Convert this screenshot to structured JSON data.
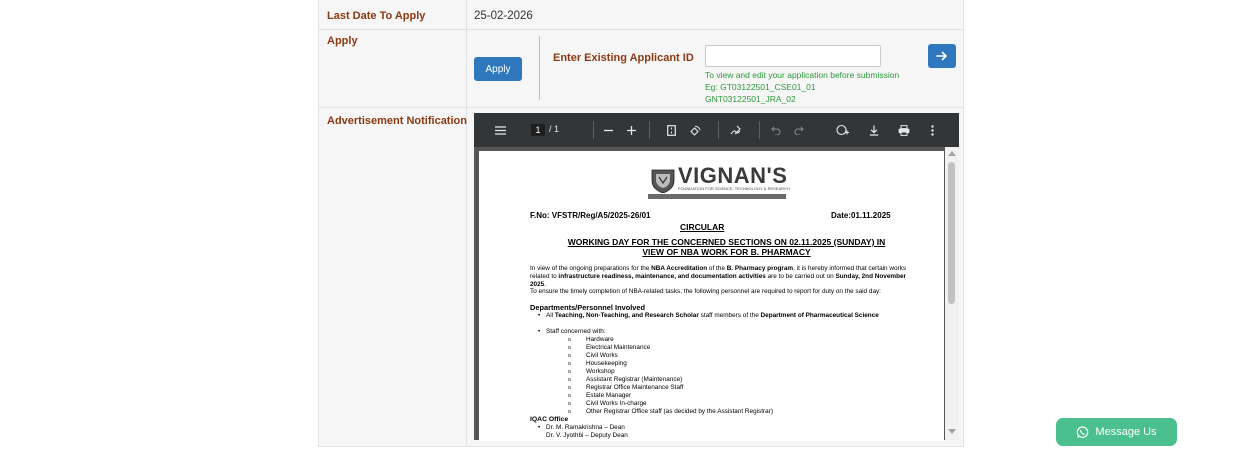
{
  "details": {
    "last_date_label": "Last Date To Apply",
    "last_date_value": "25-02-2026",
    "apply_label": "Apply",
    "apply_button": "Apply",
    "existing_id_label": "Enter Existing Applicant ID",
    "existing_id_value": "",
    "existing_id_placeholder": "",
    "hint_line1": "To view and edit your application before submission",
    "hint_line2": "Eg: GT03122501_CSE01_01",
    "hint_line3": "GNT03122501_JRA_02",
    "advertisement_label": "Advertisement Notification"
  },
  "pdf_viewer": {
    "current_page": "1",
    "total_pages": "/ 1",
    "icons": [
      "menu-icon",
      "zoom-out-icon",
      "zoom-in-icon",
      "fit-page-icon",
      "rotate-icon",
      "draw-icon",
      "undo-icon",
      "redo-icon",
      "add-text-icon",
      "download-icon",
      "print-icon",
      "more-options-icon"
    ]
  },
  "document": {
    "logo_text": "VIGNAN'S",
    "logo_subtitle": "FOUNDATION FOR SCIENCE, TECHNOLOGY & RESEARCH",
    "ref_no": "F.No: VFSTR/Reg/A5/2025-26/01",
    "date": "Date:01.11.2025",
    "circular": "CIRCULAR",
    "heading_line1": "WORKING DAY FOR THE CONCERNED SECTIONS ON 02.11.2025 (SUNDAY) IN",
    "heading_line2": "VIEW OF NBA WORK FOR B. PHARMACY",
    "para1_part1": "In view of the ongoing preparations for the ",
    "para1_bold1": "NBA Accreditation",
    "para1_part2": " of the ",
    "para1_bold2": "B. Pharmacy program",
    "para1_part3": ", it is hereby informed that certain works related to ",
    "para1_bold3": "infrastructure readiness, maintenance, and documentation activities",
    "para1_part4": " are to be carried out on ",
    "para1_bold4": "Sunday, 2nd November 2025",
    "para1_part5": ".",
    "para2": "To ensure the timely completion of NBA-related tasks, the following personnel are required to report for duty on the said day:",
    "departments_heading": "Departments/Personnel Involved",
    "bullet1_part1": "All ",
    "bullet1_bold1": "Teaching, Non-Teaching, and Research Scholar",
    "bullet1_part2": " staff members of the ",
    "bullet1_bold2": "Department of Pharmaceutical Science",
    "bullet2": "Staff concerned with:",
    "staff_items": [
      "Hardware",
      "Electrical Maintenance",
      "Civil Works",
      "Housekeeping",
      "Workshop",
      "Assistant Registrar (Maintenance)",
      "Registrar Office Maintenance Staff",
      "Estate Manager",
      "Civil Works In-charge",
      "Other Registrar Office staff (as decided by the Assistant Registrar)"
    ],
    "iqac_heading": "IQAC Office",
    "iqac_items": [
      "Dr. M. Ramakrishna – Dean",
      "Dr. V. Jyothbi – Deputy Dean"
    ]
  },
  "message_button": "Message Us",
  "colors": {
    "label": "#8a3a12",
    "button_blue": "#2f78bd",
    "hint_green": "#2e9a3c",
    "message_green": "#49c08d",
    "toolbar": "#323639"
  }
}
